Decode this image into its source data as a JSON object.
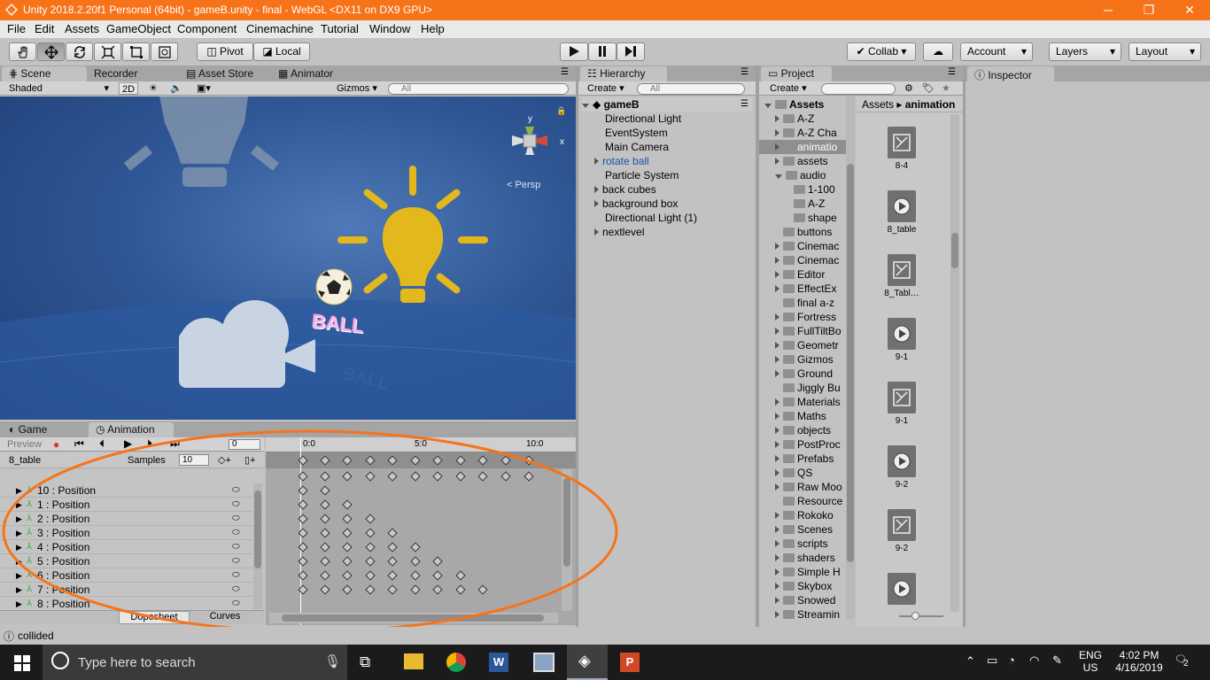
{
  "window": {
    "title": "Unity 2018.2.20f1 Personal (64bit) - gameB.unity - final - WebGL <DX11 on DX9 GPU>",
    "minimize": "─",
    "maximize": "❐",
    "close": "✕"
  },
  "menu": [
    "File",
    "Edit",
    "Assets",
    "GameObject",
    "Component",
    "Cinemachine",
    "Tutorial",
    "Window",
    "Help"
  ],
  "toolbar": {
    "pivot": "Pivot",
    "local": "Local",
    "collab": "Collab",
    "account": "Account",
    "layers": "Layers",
    "layout": "Layout"
  },
  "scene": {
    "tabs": [
      "Scene",
      "Recorder",
      "Asset Store",
      "Animator"
    ],
    "shading": "Shaded",
    "mode2d": "2D",
    "gizmos": "Gizmos",
    "search_placeholder": "All",
    "persp": "Persp",
    "ball_text": "BALL",
    "ghost_text": "BALL"
  },
  "animation": {
    "tabs": [
      "Game",
      "Animation"
    ],
    "preview": "Preview",
    "frame": "0",
    "clip": "8_table",
    "samples_label": "Samples",
    "samples": "10",
    "time_start": "0:0",
    "time_mid": "5:0",
    "time_end": "10:0",
    "rows": [
      "10 : Position",
      "1 : Position",
      "2 : Position",
      "3 : Position",
      "4 : Position",
      "5 : Position",
      "6 : Position",
      "7 : Position",
      "8 : Position"
    ],
    "dopesheet": "Dopesheet",
    "curves": "Curves"
  },
  "hierarchy": {
    "tab": "Hierarchy",
    "create": "Create",
    "search_placeholder": "All",
    "scene": "gameB",
    "items": [
      "Directional Light",
      "EventSystem",
      "Main Camera",
      "rotate ball",
      "Particle System",
      "back cubes",
      "background box",
      "Directional Light (1)",
      "nextlevel"
    ]
  },
  "project": {
    "tab": "Project",
    "create": "Create",
    "root": "Assets",
    "folders": [
      "A-Z",
      "A-Z Cha",
      "animatio",
      "assets",
      "audio",
      "1-100",
      "A-Z",
      "shape",
      "buttons",
      "Cinemac",
      "Cinemac",
      "Editor",
      "EffectEx",
      "final a-z",
      "Fortress",
      "FullTiltBo",
      "Geometr",
      "Gizmos",
      "Ground",
      "Jiggly Bu",
      "Materials",
      "Maths",
      "objects",
      "PostProc",
      "Prefabs",
      "QS",
      "Raw Moo",
      "Resource",
      "Rokoko",
      "Scenes",
      "scripts",
      "shaders",
      "Simple H",
      "Skybox",
      "Snowed",
      "Streamin"
    ],
    "breadcrumb_root": "Assets",
    "breadcrumb_current": "animation",
    "assets": [
      "8-4",
      "8_table",
      "8_Tabl…",
      "9-1",
      "9-1",
      "9-2",
      "9-2"
    ]
  },
  "inspector": {
    "tab": "Inspector"
  },
  "status": {
    "text": "collided"
  },
  "taskbar": {
    "search": "Type here to search",
    "lang": "ENG",
    "region": "US",
    "time": "4:02 PM",
    "date": "4/16/2019",
    "notif": "2"
  },
  "colors": {
    "titlebar": "#f7731a",
    "annotation": "#f7731a",
    "selected_blue": "#1c4fa8"
  }
}
